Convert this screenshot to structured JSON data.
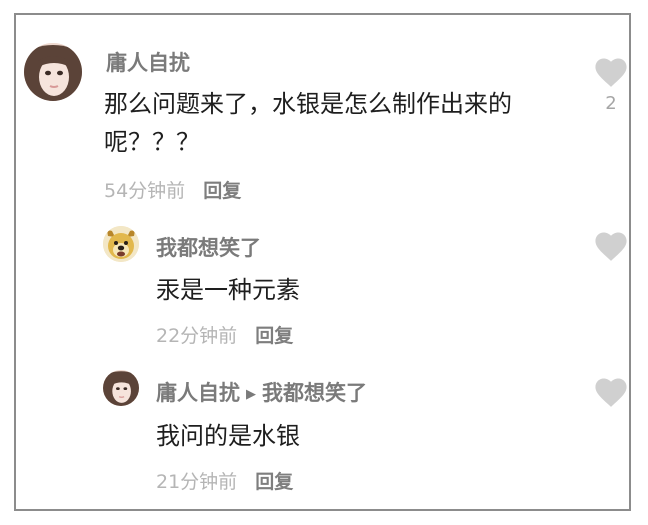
{
  "comments": [
    {
      "username": "庸人自扰",
      "text": "那么问题来了，水银是怎么制作出来的呢？？？",
      "time": "54分钟前",
      "reply_label": "回复",
      "like_count": "2",
      "avatar": "girl-avatar"
    },
    {
      "username": "我都想笑了",
      "text": "汞是一种元素",
      "time": "22分钟前",
      "reply_label": "回复",
      "avatar": "dog-avatar"
    },
    {
      "username": "庸人自扰",
      "reply_to": "我都想笑了",
      "text": "我问的是水银",
      "time": "21分钟前",
      "reply_label": "回复",
      "avatar": "girl-avatar"
    }
  ],
  "icons": {
    "like": "heart-icon",
    "reply_arrow": "play-arrow-icon"
  },
  "colors": {
    "username": "#7a7a7a",
    "time": "#b5b5b5",
    "heart": "#d0d0d0",
    "text": "#1e1e1e"
  }
}
